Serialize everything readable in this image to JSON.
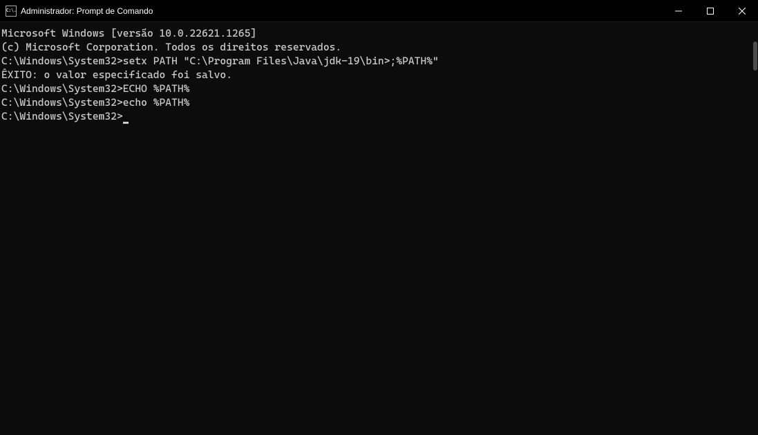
{
  "window": {
    "title": "Administrador: Prompt de Comando",
    "icon_label": "C:\\."
  },
  "terminal": {
    "line1": "Microsoft Windows [versão 10.0.22621.1265]",
    "line2": "(c) Microsoft Corporation. Todos os direitos reservados.",
    "blank1": "",
    "prompt1_path": "C:\\Windows\\System32>",
    "prompt1_cmd": "setx PATH \"C:\\Program Files\\Java\\jdk-19\\bin>;%PATH%\"",
    "blank2": "",
    "result1": "ÊXITO: o valor especificado foi salvo.",
    "blank3": "",
    "prompt2_path": "C:\\Windows\\System32>",
    "prompt2_cmd": "ECHO %PATH%",
    "blank4": "",
    "prompt3_path": "C:\\Windows\\System32>",
    "prompt3_cmd": "echo %PATH%",
    "blank5": "",
    "prompt4_path": "C:\\Windows\\System32>"
  }
}
